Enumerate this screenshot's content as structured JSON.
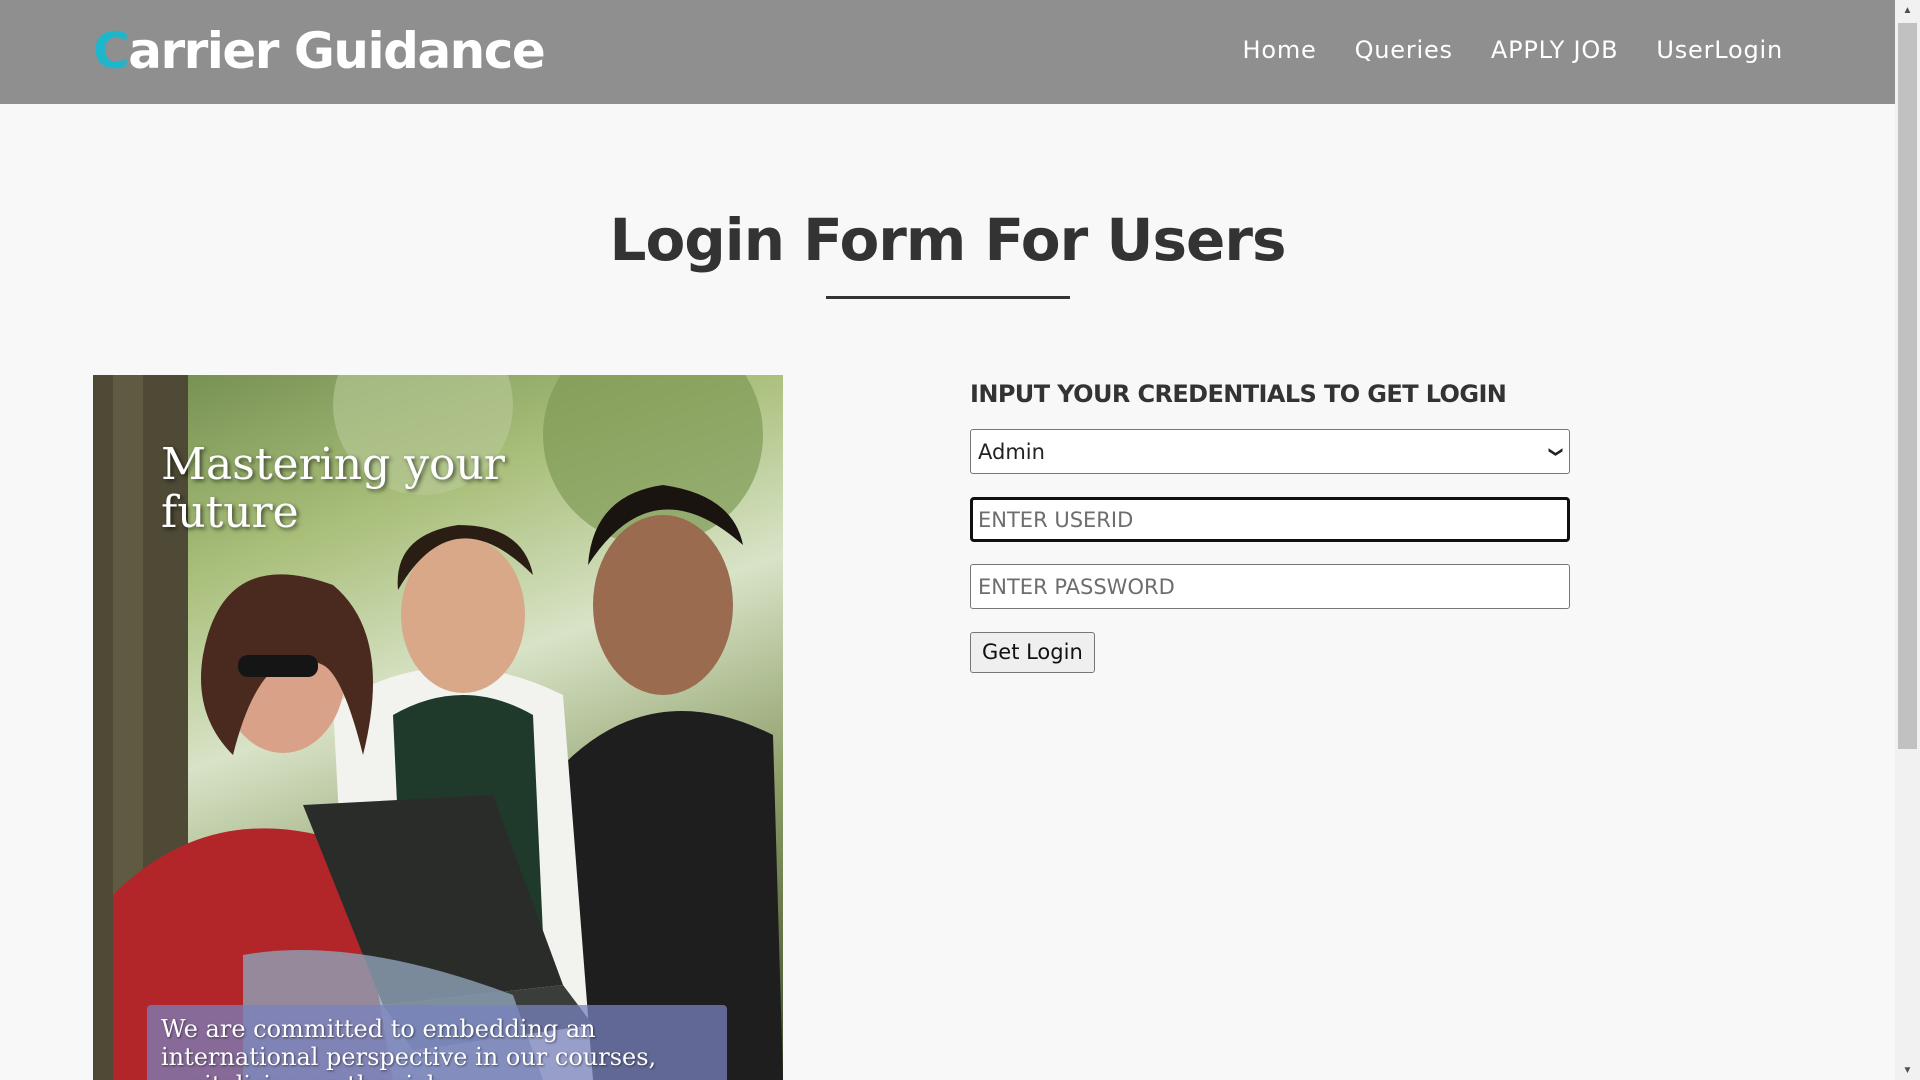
{
  "header": {
    "brand_first_letter": "C",
    "brand_rest": "arrier Guidance",
    "nav": [
      "Home",
      "Queries",
      "APPLY JOB",
      "UserLogin"
    ]
  },
  "main": {
    "title": "Login Form For Users",
    "hero": {
      "heading": "Mastering your future",
      "caption": "We are committed to embedding an international perspective in our courses, capitalising on the rich"
    },
    "form": {
      "heading": "INPUT YOUR CREDENTIALS TO GET LOGIN",
      "role_selected": "Admin",
      "userid_placeholder": "ENTER USERID",
      "password_placeholder": "ENTER PASSWORD",
      "submit_label": "Get Login"
    }
  },
  "colors": {
    "header_bg": "#8f8f8f",
    "brand_accent": "#1fb6cc",
    "page_bg": "#f8f8f8",
    "text": "#333333"
  },
  "icons": [
    "chevron-down-icon",
    "scroll-up-arrow-icon",
    "scroll-down-arrow-icon"
  ]
}
